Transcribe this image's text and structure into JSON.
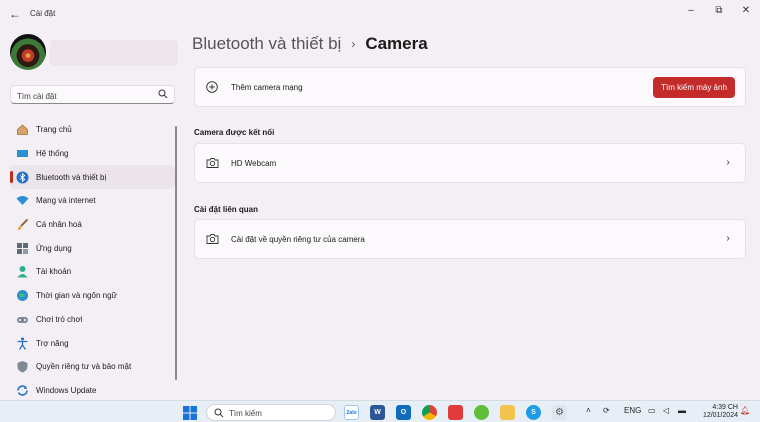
{
  "window": {
    "app_title": "Cài đặt"
  },
  "search": {
    "placeholder": "Tìm cài đặt"
  },
  "sidebar": {
    "items": [
      {
        "label": "Trang chủ",
        "icon": "home-icon"
      },
      {
        "label": "Hệ thống",
        "icon": "system-icon"
      },
      {
        "label": "Bluetooth và thiết bị",
        "icon": "bluetooth-icon",
        "active": true
      },
      {
        "label": "Mạng và internet",
        "icon": "wifi-icon"
      },
      {
        "label": "Cá nhân hoá",
        "icon": "brush-icon"
      },
      {
        "label": "Ứng dụng",
        "icon": "apps-icon"
      },
      {
        "label": "Tài khoản",
        "icon": "account-icon"
      },
      {
        "label": "Thời gian và ngôn ngữ",
        "icon": "globe-clock-icon"
      },
      {
        "label": "Chơi trò chơi",
        "icon": "gamepad-icon"
      },
      {
        "label": "Trợ năng",
        "icon": "accessibility-icon"
      },
      {
        "label": "Quyền riêng tư và bảo mật",
        "icon": "shield-icon"
      },
      {
        "label": "Windows Update",
        "icon": "update-icon"
      }
    ]
  },
  "header": {
    "breadcrumb_parent": "Bluetooth và thiết bị",
    "breadcrumb_sep": "›",
    "breadcrumb_current": "Camera"
  },
  "main": {
    "add_network_camera": {
      "label": "Thêm camera mạng",
      "button": "Tìm kiếm máy ảnh"
    },
    "connected_section": "Camera được kết nối",
    "connected_cameras": [
      {
        "label": "HD Webcam"
      }
    ],
    "related_section": "Cài đặt liên quan",
    "related_settings": [
      {
        "label": "Cài đặt về quyền riêng tư của camera"
      }
    ]
  },
  "taskbar": {
    "search_placeholder": "Tìm kiếm",
    "apps": [
      "zalo-icon",
      "word-icon",
      "outlook-icon",
      "chrome-icon",
      "app-icon",
      "game-icon",
      "file-explorer-icon",
      "skype-icon",
      "settings-icon"
    ],
    "language": "ENG",
    "time": "4:39 CH",
    "date": "12/01/2024",
    "zalo_label": "Zalo",
    "word_label": "W",
    "outlook_label": "O",
    "skype_label": "S"
  },
  "colors": {
    "accent": "#c42b2b",
    "background": "#f4eff4",
    "card": "#fbf9fb",
    "taskbar": "#e8eef5"
  }
}
